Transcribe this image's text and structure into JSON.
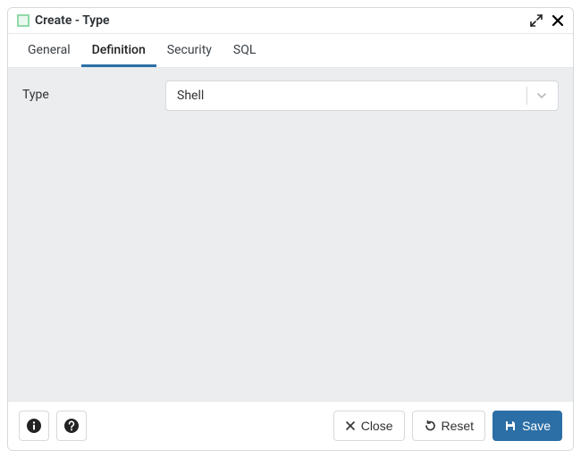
{
  "titlebar": {
    "title": "Create - Type"
  },
  "tabs": [
    {
      "label": "General"
    },
    {
      "label": "Definition"
    },
    {
      "label": "Security"
    },
    {
      "label": "SQL"
    }
  ],
  "active_tab_index": 1,
  "form": {
    "type_label": "Type",
    "type_value": "Shell"
  },
  "footer": {
    "close_label": "Close",
    "reset_label": "Reset",
    "save_label": "Save"
  }
}
